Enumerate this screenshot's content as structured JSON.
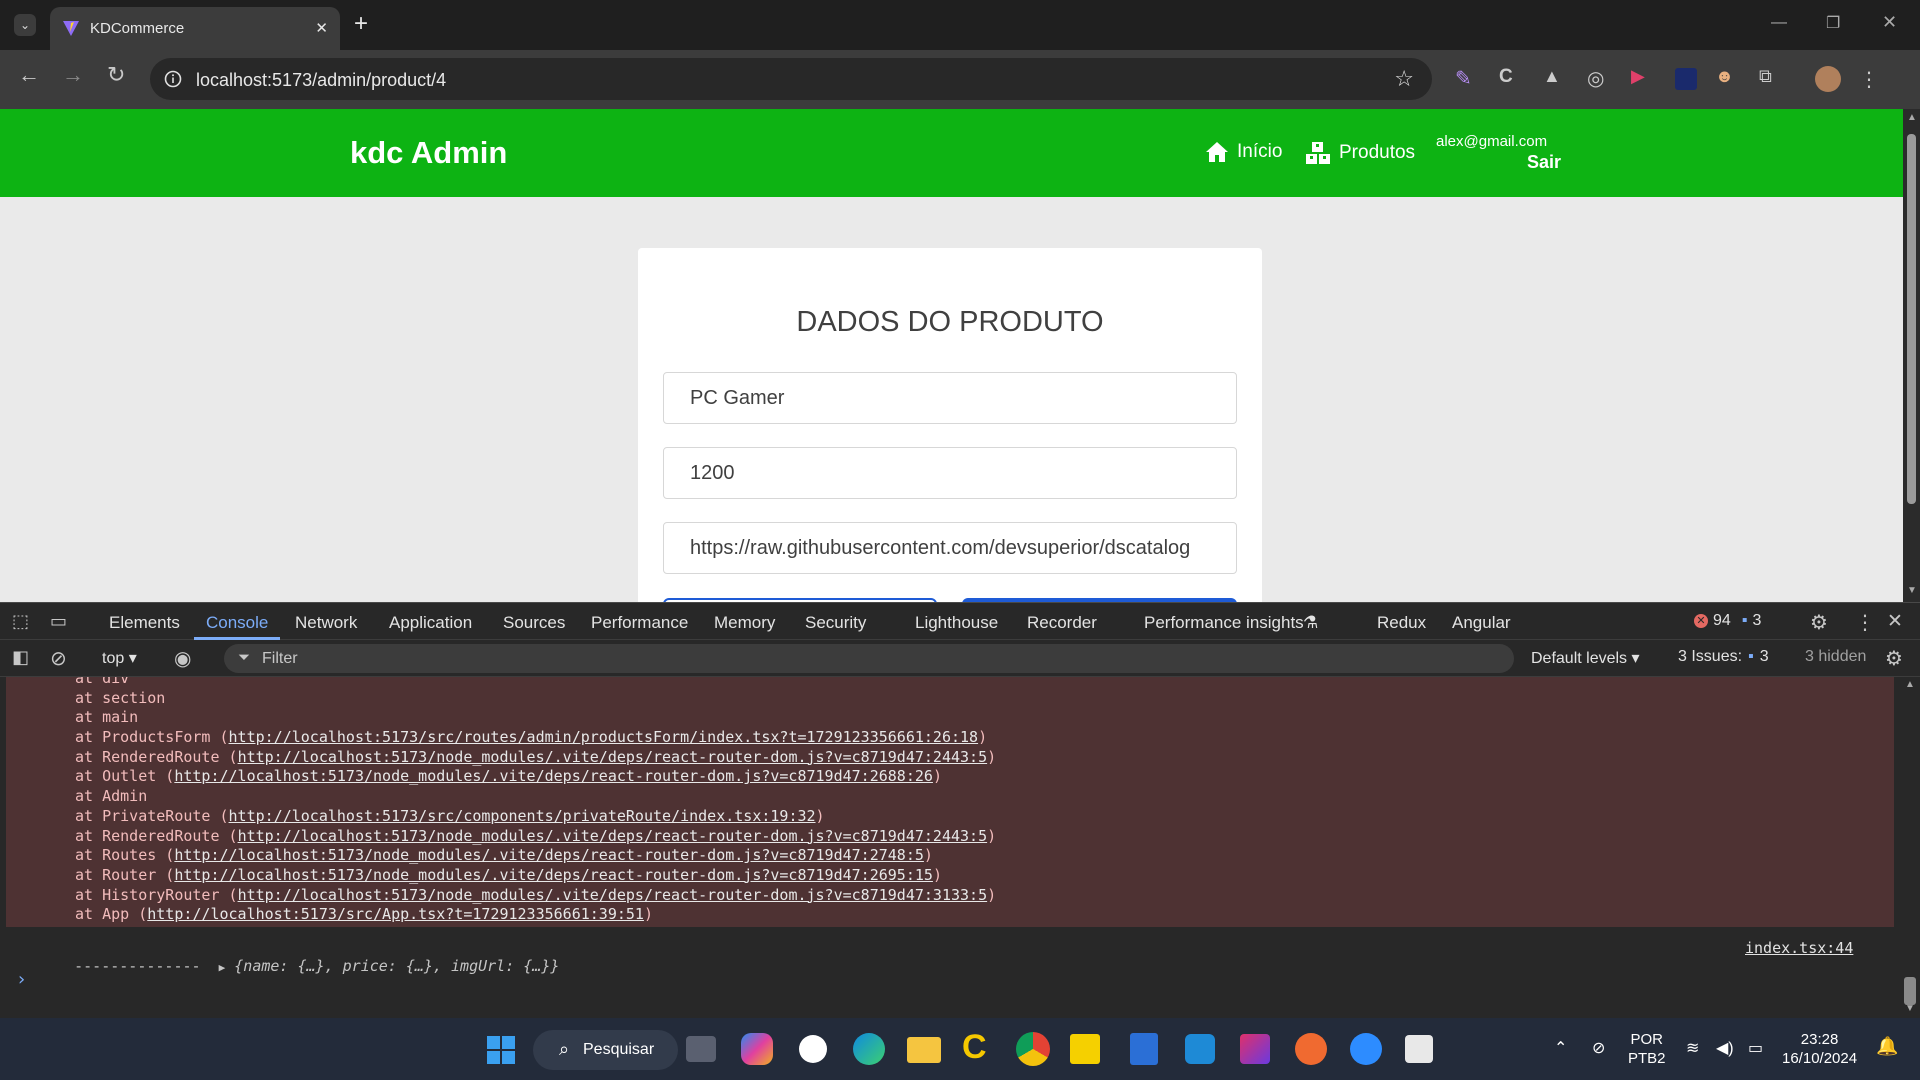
{
  "browser": {
    "tab_title": "KDCommerce",
    "tab_close": "✕",
    "new_tab": "+",
    "url": "localhost:5173/admin/product/4"
  },
  "navbar": {
    "brand": "kdc Admin",
    "home_label": "Início",
    "products_label": "Produtos",
    "email": "alex@gmail.com",
    "logout": "Sair",
    "color": "#0db313"
  },
  "form": {
    "title": "DADOS DO PRODUTO",
    "name_value": "PC Gamer",
    "price_value": "1200",
    "img_url_value": "https://raw.githubusercontent.com/devsuperior/dscatalog"
  },
  "devtools": {
    "tabs": [
      "Elements",
      "Console",
      "Network",
      "Application",
      "Sources",
      "Performance",
      "Memory",
      "Security",
      "Lighthouse",
      "Recorder",
      "Performance insights",
      "Redux",
      "Angular"
    ],
    "active_tab": "Console",
    "error_count": "94",
    "message_count": "3",
    "context": "top",
    "filter_placeholder": "Filter",
    "levels": "Default levels",
    "issues_label": "3 Issues:",
    "issues_count": "3",
    "hidden": "3 hidden",
    "stack": [
      {
        "at": "at div",
        "link": ""
      },
      {
        "at": "at section",
        "link": ""
      },
      {
        "at": "at main",
        "link": ""
      },
      {
        "at": "at ProductsForm (",
        "link": "http://localhost:5173/src/routes/admin/productsForm/index.tsx?t=1729123356661:26:18",
        "end": ")"
      },
      {
        "at": "at RenderedRoute (",
        "link": "http://localhost:5173/node_modules/.vite/deps/react-router-dom.js?v=c8719d47:2443:5",
        "end": ")"
      },
      {
        "at": "at Outlet (",
        "link": "http://localhost:5173/node_modules/.vite/deps/react-router-dom.js?v=c8719d47:2688:26",
        "end": ")"
      },
      {
        "at": "at Admin",
        "link": ""
      },
      {
        "at": "at PrivateRoute (",
        "link": "http://localhost:5173/src/components/privateRoute/index.tsx:19:32",
        "end": ")"
      },
      {
        "at": "at RenderedRoute (",
        "link": "http://localhost:5173/node_modules/.vite/deps/react-router-dom.js?v=c8719d47:2443:5",
        "end": ")"
      },
      {
        "at": "at Routes (",
        "link": "http://localhost:5173/node_modules/.vite/deps/react-router-dom.js?v=c8719d47:2748:5",
        "end": ")"
      },
      {
        "at": "at Router (",
        "link": "http://localhost:5173/node_modules/.vite/deps/react-router-dom.js?v=c8719d47:2695:15",
        "end": ")"
      },
      {
        "at": "at HistoryRouter (",
        "link": "http://localhost:5173/node_modules/.vite/deps/react-router-dom.js?v=c8719d47:3133:5",
        "end": ")"
      },
      {
        "at": "at App (",
        "link": "http://localhost:5173/src/App.tsx?t=1729123356661:39:51",
        "end": ")"
      }
    ],
    "log_prefix": "--------------",
    "log_object": "{name: {…}, price: {…}, imgUrl: {…}}",
    "log_source": "index.tsx:44",
    "prompt": "›"
  },
  "taskbar": {
    "search_label": "Pesquisar",
    "lang": "POR",
    "layout": "PTB2",
    "time": "23:28",
    "date": "16/10/2024"
  }
}
